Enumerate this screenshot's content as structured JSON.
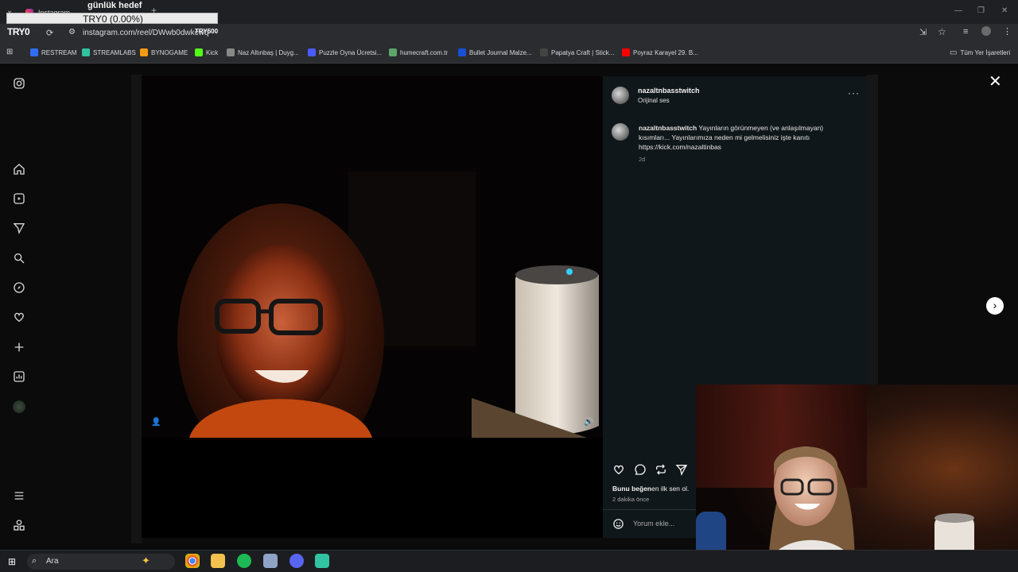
{
  "browser": {
    "tab_title": "Instagram",
    "url": "instagram.com/reel/DWwb0dwkcwq",
    "bookmarks": [
      {
        "label": "RESTREAM",
        "icon": "restream-icon",
        "color": "#2f6df6"
      },
      {
        "label": "STREAMLABS",
        "icon": "streamlabs-icon",
        "color": "#31c3a2"
      },
      {
        "label": "BYNOGAME",
        "icon": "bynogame-icon",
        "color": "#f39c12"
      },
      {
        "label": "Kick",
        "icon": "kick-icon",
        "color": "#53fc18"
      },
      {
        "label": "Naz Altınbaş | Duyg...",
        "icon": "globe-icon",
        "color": "#888888"
      },
      {
        "label": "Puzzle Oyna Ücretsi...",
        "icon": "puzzle-icon",
        "color": "#4a5cff"
      },
      {
        "label": "humecraft.com.tr",
        "icon": "humecraft-icon",
        "color": "#5ca66a"
      },
      {
        "label": "Bullet Journal Malze...",
        "icon": "shopify-icon",
        "color": "#1a4fd6"
      },
      {
        "label": "Papatya Craft | Stick...",
        "icon": "papatya-icon",
        "color": "#444444"
      },
      {
        "label": "Poyraz Karayel 29. B...",
        "icon": "youtube-icon",
        "color": "#ff0000"
      }
    ],
    "all_bookmarks": "Tüm Yer İşaretleri"
  },
  "overlay": {
    "goal_label": "günlük hedef",
    "goal_value": "TRY0 (0.00%)",
    "goal_progress": 0,
    "brand_left": "TRY0",
    "brand_right": "TRY500"
  },
  "post": {
    "username": "nazaltnbasstwitch",
    "audio": "Orijinal ses",
    "caption_user": "nazaltnbasstwitch",
    "caption_text": " Yayınların görünmeyen (ve anlaşılmayan) kısımları... Yayınlarımıza neden mi gelmelisiniz işte kanıtı https://kick.com/nazaltinbas",
    "caption_age": "2d",
    "likes_bold": "Bunu beğen",
    "likes_rest": "en ilk sen ol.",
    "time_ago": "2 dakika önce",
    "comment_placeholder": "Yorum ekle..."
  },
  "taskbar": {
    "search_label": "Ara"
  }
}
